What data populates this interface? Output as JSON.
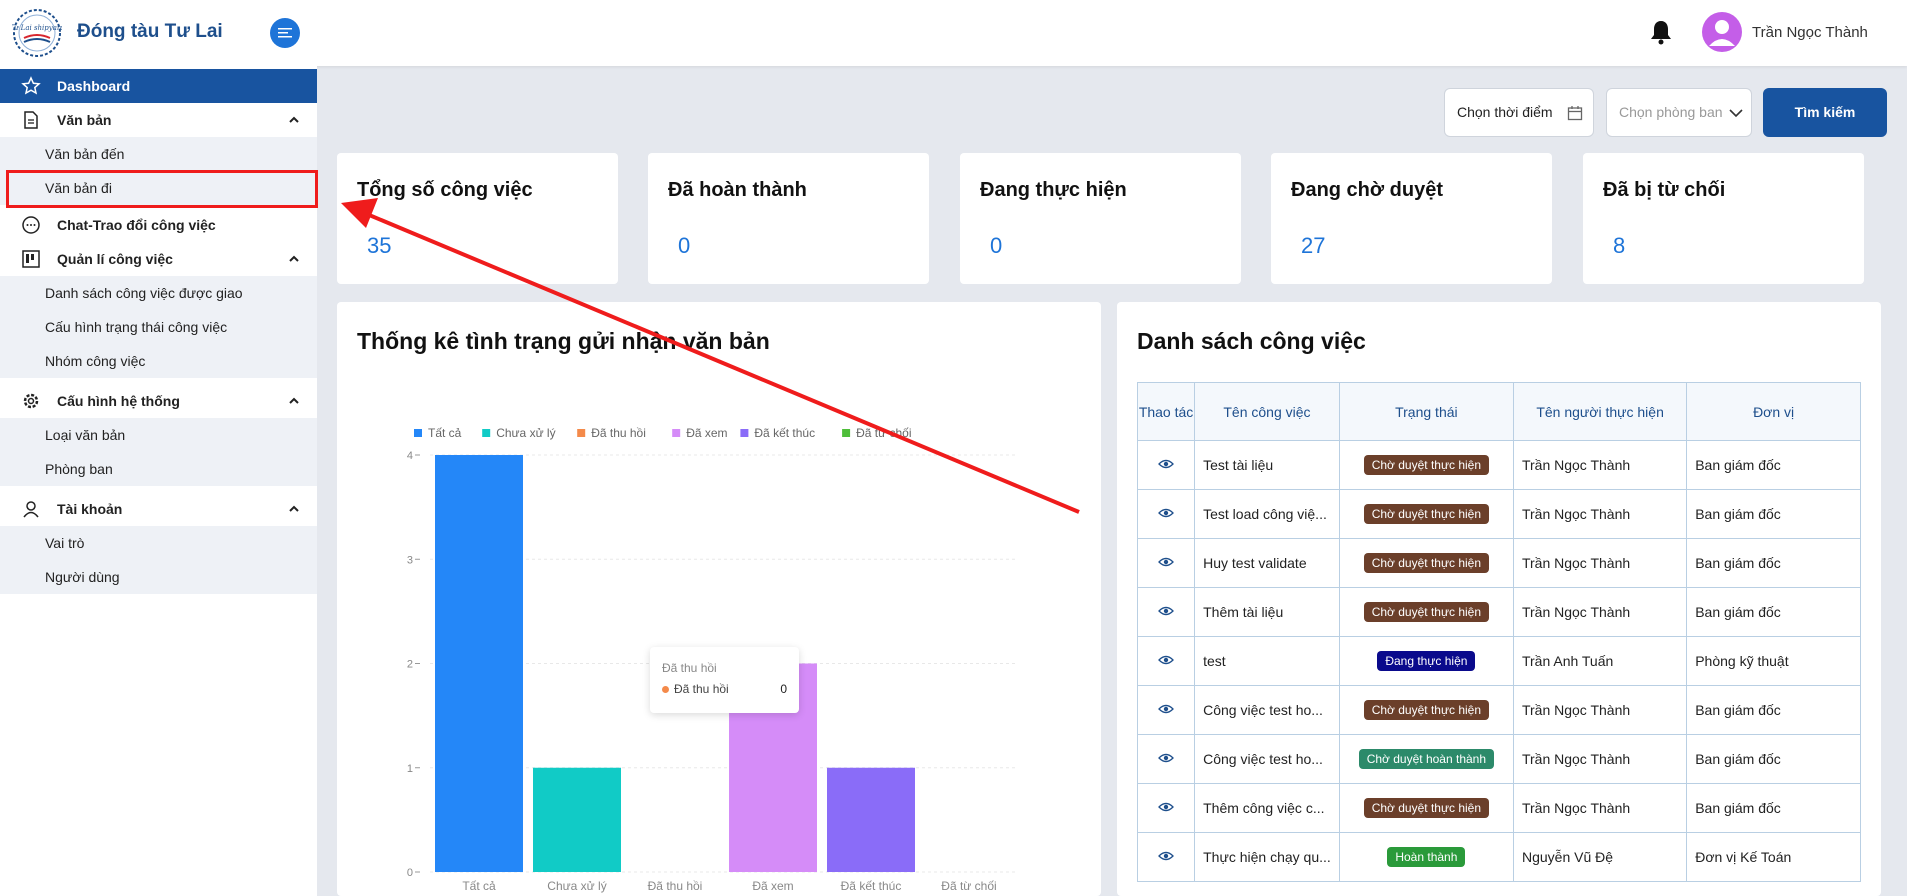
{
  "header": {
    "brand": "Đóng tàu Tư Lai",
    "logo_text": "Tư Lai shipyard",
    "username": "Trần Ngọc Thành"
  },
  "sidebar": {
    "dashboard": "Dashboard",
    "van_ban": "Văn bản",
    "van_ban_den": "Văn bản đến",
    "van_ban_di": "Văn bản đi",
    "chat": "Chat-Trao đổi công việc",
    "quan_li": "Quản lí công việc",
    "danh_sach": "Danh sách công việc được giao",
    "cau_hinh_trang_thai": "Cấu hình trạng thái công việc",
    "nhom": "Nhóm công việc",
    "cau_hinh_he_thong": "Cấu hình hệ thống",
    "loai_van_ban": "Loại văn bản",
    "phong_ban": "Phòng ban",
    "tai_khoan": "Tài khoản",
    "vai_tro": "Vai trò",
    "nguoi_dung": "Người dùng"
  },
  "filters": {
    "time_placeholder": "Chọn thời điểm",
    "dept_placeholder": "Chọn phòng ban",
    "search": "Tìm kiếm"
  },
  "cards": [
    {
      "title": "Tổng số công việc",
      "value": "35"
    },
    {
      "title": "Đã hoàn thành",
      "value": "0"
    },
    {
      "title": "Đang thực hiện",
      "value": "0"
    },
    {
      "title": "Đang chờ duyệt",
      "value": "27"
    },
    {
      "title": "Đã bị từ chối",
      "value": "8"
    }
  ],
  "chart_panel_title": "Thống kê tình trạng gửi nhận văn bản",
  "chart_data": {
    "type": "bar",
    "categories": [
      "Tất cả",
      "Chưa xử lý",
      "Đã thu hồi",
      "Đã xem",
      "Đã kết thúc",
      "Đã từ chối"
    ],
    "values": [
      4,
      1,
      0,
      2,
      1,
      0
    ],
    "colors": [
      "#2487f8",
      "#11cbc6",
      "#f48a4a",
      "#d58cf8",
      "#8a6cf8",
      "#4fbe3a"
    ],
    "legend": [
      "Tất cả",
      "Chưa xử lý",
      "Đã thu hồi",
      "Đã xem",
      "Đã kết thúc",
      "Đã từ chối"
    ],
    "yticks": [
      "0",
      "1",
      "2",
      "3",
      "4"
    ],
    "ylim": [
      0,
      4
    ],
    "legend_position": "top",
    "tooltip": {
      "title": "Đã thu hồi",
      "label": "Đã thu hồi",
      "value": "0",
      "color": "#f48a4a"
    }
  },
  "table_panel_title": "Danh sách công việc",
  "table": {
    "headers": [
      "Thao tác",
      "Tên công việc",
      "Trạng thái",
      "Tên người thực hiện",
      "Đơn vị"
    ],
    "rows": [
      {
        "name": "Test tài liệu",
        "status": "Chờ duyệt thực hiện",
        "status_color": "#6b3f2a",
        "person": "Trần Ngọc Thành",
        "unit": "Ban giám đốc"
      },
      {
        "name": "Test load công việ...",
        "status": "Chờ duyệt thực hiện",
        "status_color": "#6b3f2a",
        "person": "Trần Ngọc Thành",
        "unit": "Ban giám đốc"
      },
      {
        "name": "Huy test validate",
        "status": "Chờ duyệt thực hiện",
        "status_color": "#6b3f2a",
        "person": "Trần Ngọc Thành",
        "unit": "Ban giám đốc"
      },
      {
        "name": "Thêm tài liệu",
        "status": "Chờ duyệt thực hiện",
        "status_color": "#6b3f2a",
        "person": "Trần Ngọc Thành",
        "unit": "Ban giám đốc"
      },
      {
        "name": "test",
        "status": "Đang thực hiện",
        "status_color": "#0a0a8c",
        "person": "Trần Anh Tuấn",
        "unit": "Phòng kỹ thuật"
      },
      {
        "name": "Công việc test ho...",
        "status": "Chờ duyệt thực hiện",
        "status_color": "#6b3f2a",
        "person": "Trần Ngọc Thành",
        "unit": "Ban giám đốc"
      },
      {
        "name": "Công việc test ho...",
        "status": "Chờ duyệt hoàn thành",
        "status_color": "#2c8a6a",
        "person": "Trần Ngọc Thành",
        "unit": "Ban giám đốc"
      },
      {
        "name": "Thêm công việc c...",
        "status": "Chờ duyệt thực hiện",
        "status_color": "#6b3f2a",
        "person": "Trần Ngọc Thành",
        "unit": "Ban giám đốc"
      },
      {
        "name": "Thực hiện chạy qu...",
        "status": "Hoàn thành",
        "status_color": "#2a9a3a",
        "person": "Nguyễn Vũ Đệ",
        "unit": "Đơn vị Kế Toán"
      }
    ]
  }
}
